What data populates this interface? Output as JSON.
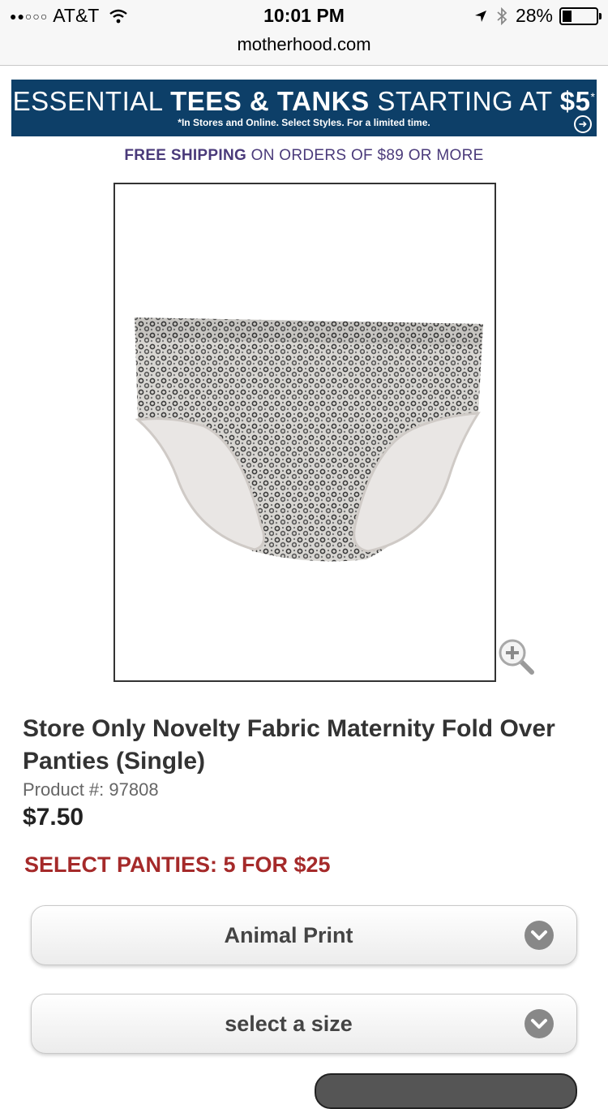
{
  "status_bar": {
    "signal": "●●○○○",
    "carrier": "AT&T",
    "time": "10:01 PM",
    "battery": "28%",
    "battery_level": 0.28
  },
  "browser": {
    "url": "motherhood.com"
  },
  "banner": {
    "head_pre": "ESSENTIAL ",
    "head_bold": "TEES & TANKS",
    "head_post": " STARTING AT ",
    "head_price": "$5",
    "head_star": "*",
    "sub": "*In Stores and Online. Select Styles. For a limited time."
  },
  "shipping": {
    "bold": "FREE SHIPPING",
    "rest": " ON ORDERS OF $89 OR MORE"
  },
  "product": {
    "title": "Store Only Novelty Fabric Maternity Fold Over Panties (Single)",
    "number": "Product #: 97808",
    "price": "$7.50",
    "promo": "SELECT PANTIES: 5 FOR $25"
  },
  "selects": {
    "color": "Animal Print",
    "size": "select a size"
  },
  "icons": {
    "zoom": "zoom-in-icon",
    "chevron": "chevron-down-icon",
    "banner_arrow": "arrow-right-circle-icon"
  },
  "colors": {
    "banner_bg": "#0d3f68",
    "shipping_text": "#4a3a7a",
    "promo_text": "#a52a2a"
  }
}
